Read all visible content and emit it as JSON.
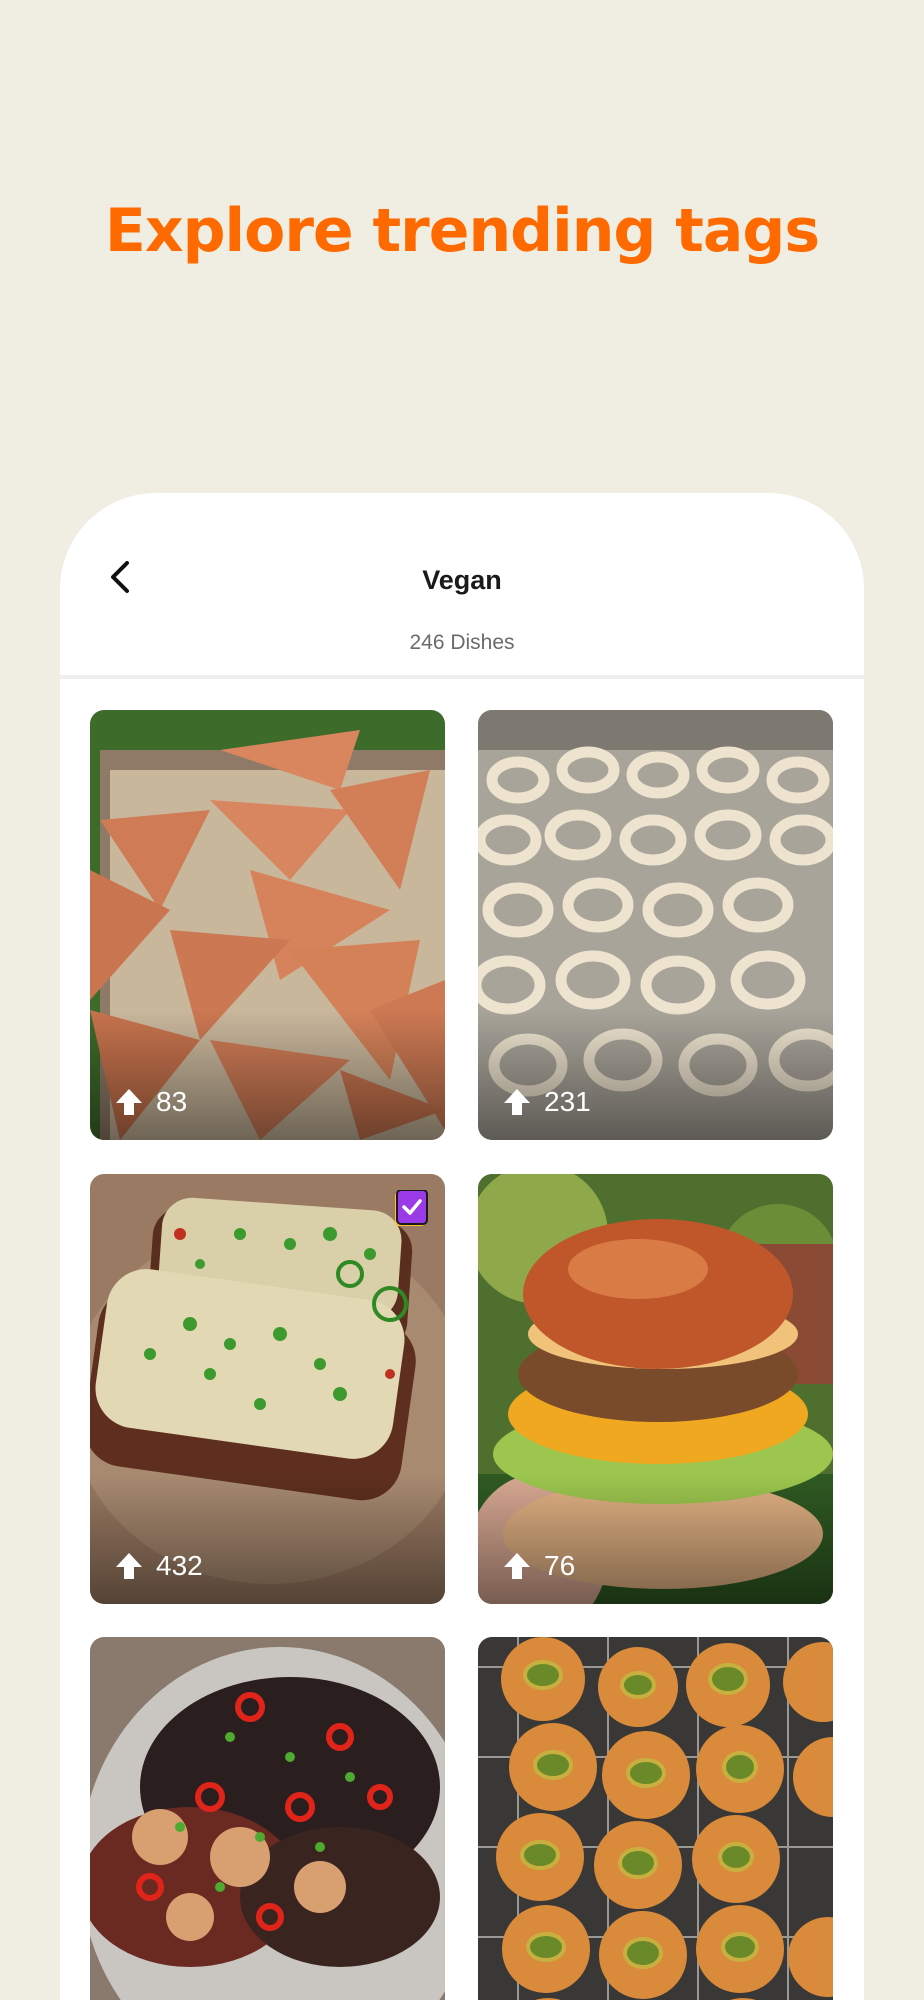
{
  "headline": "Explore trending tags",
  "screen": {
    "title": "Vegan",
    "subtitle": "246 Dishes",
    "back_icon": "chevron-left-icon"
  },
  "colors": {
    "accent": "#FF6A00",
    "background": "#F0EEE3",
    "badge": "#9B3BE8"
  },
  "dishes": [
    {
      "upvotes": "83",
      "upvote_icon": "arrow-up-icon",
      "badge": false
    },
    {
      "upvotes": "231",
      "upvote_icon": "arrow-up-icon",
      "badge": false
    },
    {
      "upvotes": "432",
      "upvote_icon": "arrow-up-icon",
      "badge": true,
      "badge_icon": "cookbook-check-icon"
    },
    {
      "upvotes": "76",
      "upvote_icon": "arrow-up-icon",
      "badge": false
    },
    {
      "upvotes": "",
      "upvote_icon": "",
      "badge": false
    },
    {
      "upvotes": "",
      "upvote_icon": "",
      "badge": false
    }
  ]
}
